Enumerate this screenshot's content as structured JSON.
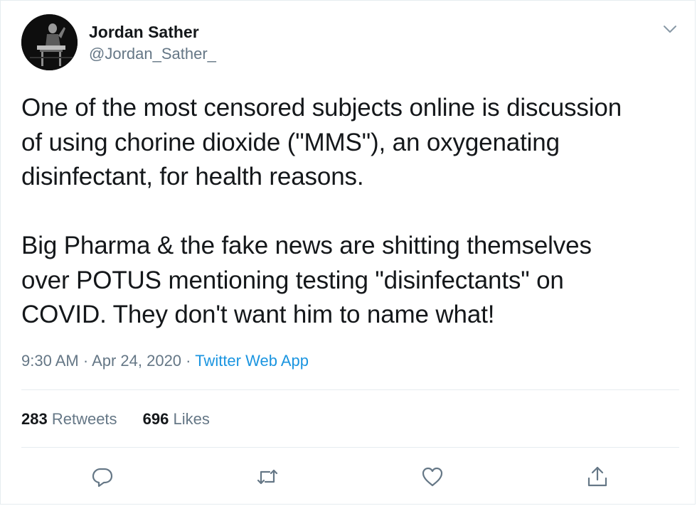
{
  "author": {
    "display_name": "Jordan Sather",
    "handle": "@Jordan_Sather_",
    "avatar_icon": "profile-photo"
  },
  "menu": {
    "icon": "chevron-down-icon"
  },
  "tweet": {
    "paragraphs": [
      "One of the most censored subjects online is discussion\nof using chorine dioxide (\"MMS\"), an oxygenating\ndisinfectant, for health reasons.",
      "Big Pharma & the fake news are shitting themselves\nover POTUS mentioning testing \"disinfectants\" on\nCOVID. They don't want him to name what!"
    ]
  },
  "meta": {
    "time": "9:30 AM",
    "separator": " · ",
    "date": "Apr 24, 2020",
    "source": "Twitter Web App"
  },
  "stats": {
    "retweets_count": "283",
    "retweets_label": " Retweets",
    "likes_count": "696",
    "likes_label": " Likes"
  },
  "actions": [
    {
      "name": "reply",
      "icon": "reply-icon"
    },
    {
      "name": "retweet",
      "icon": "retweet-icon"
    },
    {
      "name": "like",
      "icon": "heart-icon"
    },
    {
      "name": "share",
      "icon": "share-icon"
    }
  ],
  "colors": {
    "text": "#14171a",
    "secondary": "#657786",
    "link": "#1b95e0",
    "divider": "#e6ecf0"
  }
}
